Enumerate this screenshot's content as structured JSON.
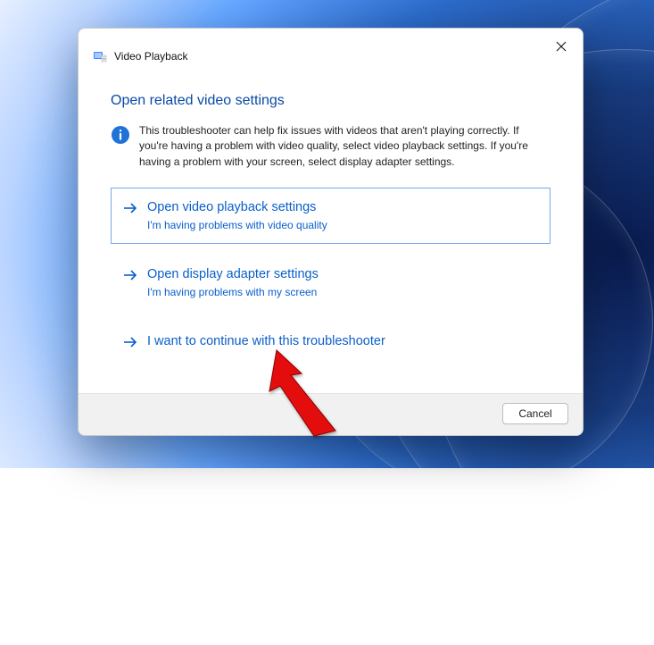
{
  "window": {
    "title": "Video Playback"
  },
  "section": {
    "heading": "Open related video settings",
    "info": "This troubleshooter can help fix issues with videos that aren't playing correctly. If you're having a problem with video quality, select video playback settings. If you're having a problem with your screen, select display adapter settings."
  },
  "options": [
    {
      "title": "Open video playback settings",
      "sub": "I'm having problems with video quality"
    },
    {
      "title": "Open display adapter settings",
      "sub": "I'm having problems with my screen"
    },
    {
      "title": "I want to continue with this troubleshooter",
      "sub": ""
    }
  ],
  "footer": {
    "cancel": "Cancel"
  }
}
